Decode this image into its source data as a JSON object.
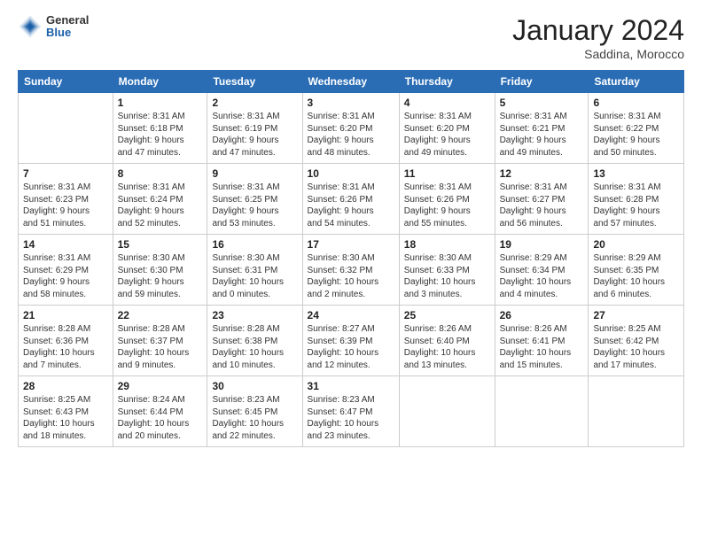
{
  "header": {
    "logo": {
      "general": "General",
      "blue": "Blue"
    },
    "title": "January 2024",
    "location": "Saddina, Morocco"
  },
  "columns": [
    "Sunday",
    "Monday",
    "Tuesday",
    "Wednesday",
    "Thursday",
    "Friday",
    "Saturday"
  ],
  "weeks": [
    [
      {
        "day": "",
        "sunrise": "",
        "sunset": "",
        "daylight": ""
      },
      {
        "day": "1",
        "sunrise": "Sunrise: 8:31 AM",
        "sunset": "Sunset: 6:18 PM",
        "daylight": "Daylight: 9 hours and 47 minutes."
      },
      {
        "day": "2",
        "sunrise": "Sunrise: 8:31 AM",
        "sunset": "Sunset: 6:19 PM",
        "daylight": "Daylight: 9 hours and 47 minutes."
      },
      {
        "day": "3",
        "sunrise": "Sunrise: 8:31 AM",
        "sunset": "Sunset: 6:20 PM",
        "daylight": "Daylight: 9 hours and 48 minutes."
      },
      {
        "day": "4",
        "sunrise": "Sunrise: 8:31 AM",
        "sunset": "Sunset: 6:20 PM",
        "daylight": "Daylight: 9 hours and 49 minutes."
      },
      {
        "day": "5",
        "sunrise": "Sunrise: 8:31 AM",
        "sunset": "Sunset: 6:21 PM",
        "daylight": "Daylight: 9 hours and 49 minutes."
      },
      {
        "day": "6",
        "sunrise": "Sunrise: 8:31 AM",
        "sunset": "Sunset: 6:22 PM",
        "daylight": "Daylight: 9 hours and 50 minutes."
      }
    ],
    [
      {
        "day": "7",
        "sunrise": "Sunrise: 8:31 AM",
        "sunset": "Sunset: 6:23 PM",
        "daylight": "Daylight: 9 hours and 51 minutes."
      },
      {
        "day": "8",
        "sunrise": "Sunrise: 8:31 AM",
        "sunset": "Sunset: 6:24 PM",
        "daylight": "Daylight: 9 hours and 52 minutes."
      },
      {
        "day": "9",
        "sunrise": "Sunrise: 8:31 AM",
        "sunset": "Sunset: 6:25 PM",
        "daylight": "Daylight: 9 hours and 53 minutes."
      },
      {
        "day": "10",
        "sunrise": "Sunrise: 8:31 AM",
        "sunset": "Sunset: 6:26 PM",
        "daylight": "Daylight: 9 hours and 54 minutes."
      },
      {
        "day": "11",
        "sunrise": "Sunrise: 8:31 AM",
        "sunset": "Sunset: 6:26 PM",
        "daylight": "Daylight: 9 hours and 55 minutes."
      },
      {
        "day": "12",
        "sunrise": "Sunrise: 8:31 AM",
        "sunset": "Sunset: 6:27 PM",
        "daylight": "Daylight: 9 hours and 56 minutes."
      },
      {
        "day": "13",
        "sunrise": "Sunrise: 8:31 AM",
        "sunset": "Sunset: 6:28 PM",
        "daylight": "Daylight: 9 hours and 57 minutes."
      }
    ],
    [
      {
        "day": "14",
        "sunrise": "Sunrise: 8:31 AM",
        "sunset": "Sunset: 6:29 PM",
        "daylight": "Daylight: 9 hours and 58 minutes."
      },
      {
        "day": "15",
        "sunrise": "Sunrise: 8:30 AM",
        "sunset": "Sunset: 6:30 PM",
        "daylight": "Daylight: 9 hours and 59 minutes."
      },
      {
        "day": "16",
        "sunrise": "Sunrise: 8:30 AM",
        "sunset": "Sunset: 6:31 PM",
        "daylight": "Daylight: 10 hours and 0 minutes."
      },
      {
        "day": "17",
        "sunrise": "Sunrise: 8:30 AM",
        "sunset": "Sunset: 6:32 PM",
        "daylight": "Daylight: 10 hours and 2 minutes."
      },
      {
        "day": "18",
        "sunrise": "Sunrise: 8:30 AM",
        "sunset": "Sunset: 6:33 PM",
        "daylight": "Daylight: 10 hours and 3 minutes."
      },
      {
        "day": "19",
        "sunrise": "Sunrise: 8:29 AM",
        "sunset": "Sunset: 6:34 PM",
        "daylight": "Daylight: 10 hours and 4 minutes."
      },
      {
        "day": "20",
        "sunrise": "Sunrise: 8:29 AM",
        "sunset": "Sunset: 6:35 PM",
        "daylight": "Daylight: 10 hours and 6 minutes."
      }
    ],
    [
      {
        "day": "21",
        "sunrise": "Sunrise: 8:28 AM",
        "sunset": "Sunset: 6:36 PM",
        "daylight": "Daylight: 10 hours and 7 minutes."
      },
      {
        "day": "22",
        "sunrise": "Sunrise: 8:28 AM",
        "sunset": "Sunset: 6:37 PM",
        "daylight": "Daylight: 10 hours and 9 minutes."
      },
      {
        "day": "23",
        "sunrise": "Sunrise: 8:28 AM",
        "sunset": "Sunset: 6:38 PM",
        "daylight": "Daylight: 10 hours and 10 minutes."
      },
      {
        "day": "24",
        "sunrise": "Sunrise: 8:27 AM",
        "sunset": "Sunset: 6:39 PM",
        "daylight": "Daylight: 10 hours and 12 minutes."
      },
      {
        "day": "25",
        "sunrise": "Sunrise: 8:26 AM",
        "sunset": "Sunset: 6:40 PM",
        "daylight": "Daylight: 10 hours and 13 minutes."
      },
      {
        "day": "26",
        "sunrise": "Sunrise: 8:26 AM",
        "sunset": "Sunset: 6:41 PM",
        "daylight": "Daylight: 10 hours and 15 minutes."
      },
      {
        "day": "27",
        "sunrise": "Sunrise: 8:25 AM",
        "sunset": "Sunset: 6:42 PM",
        "daylight": "Daylight: 10 hours and 17 minutes."
      }
    ],
    [
      {
        "day": "28",
        "sunrise": "Sunrise: 8:25 AM",
        "sunset": "Sunset: 6:43 PM",
        "daylight": "Daylight: 10 hours and 18 minutes."
      },
      {
        "day": "29",
        "sunrise": "Sunrise: 8:24 AM",
        "sunset": "Sunset: 6:44 PM",
        "daylight": "Daylight: 10 hours and 20 minutes."
      },
      {
        "day": "30",
        "sunrise": "Sunrise: 8:23 AM",
        "sunset": "Sunset: 6:45 PM",
        "daylight": "Daylight: 10 hours and 22 minutes."
      },
      {
        "day": "31",
        "sunrise": "Sunrise: 8:23 AM",
        "sunset": "Sunset: 6:47 PM",
        "daylight": "Daylight: 10 hours and 23 minutes."
      },
      {
        "day": "",
        "sunrise": "",
        "sunset": "",
        "daylight": ""
      },
      {
        "day": "",
        "sunrise": "",
        "sunset": "",
        "daylight": ""
      },
      {
        "day": "",
        "sunrise": "",
        "sunset": "",
        "daylight": ""
      }
    ]
  ]
}
